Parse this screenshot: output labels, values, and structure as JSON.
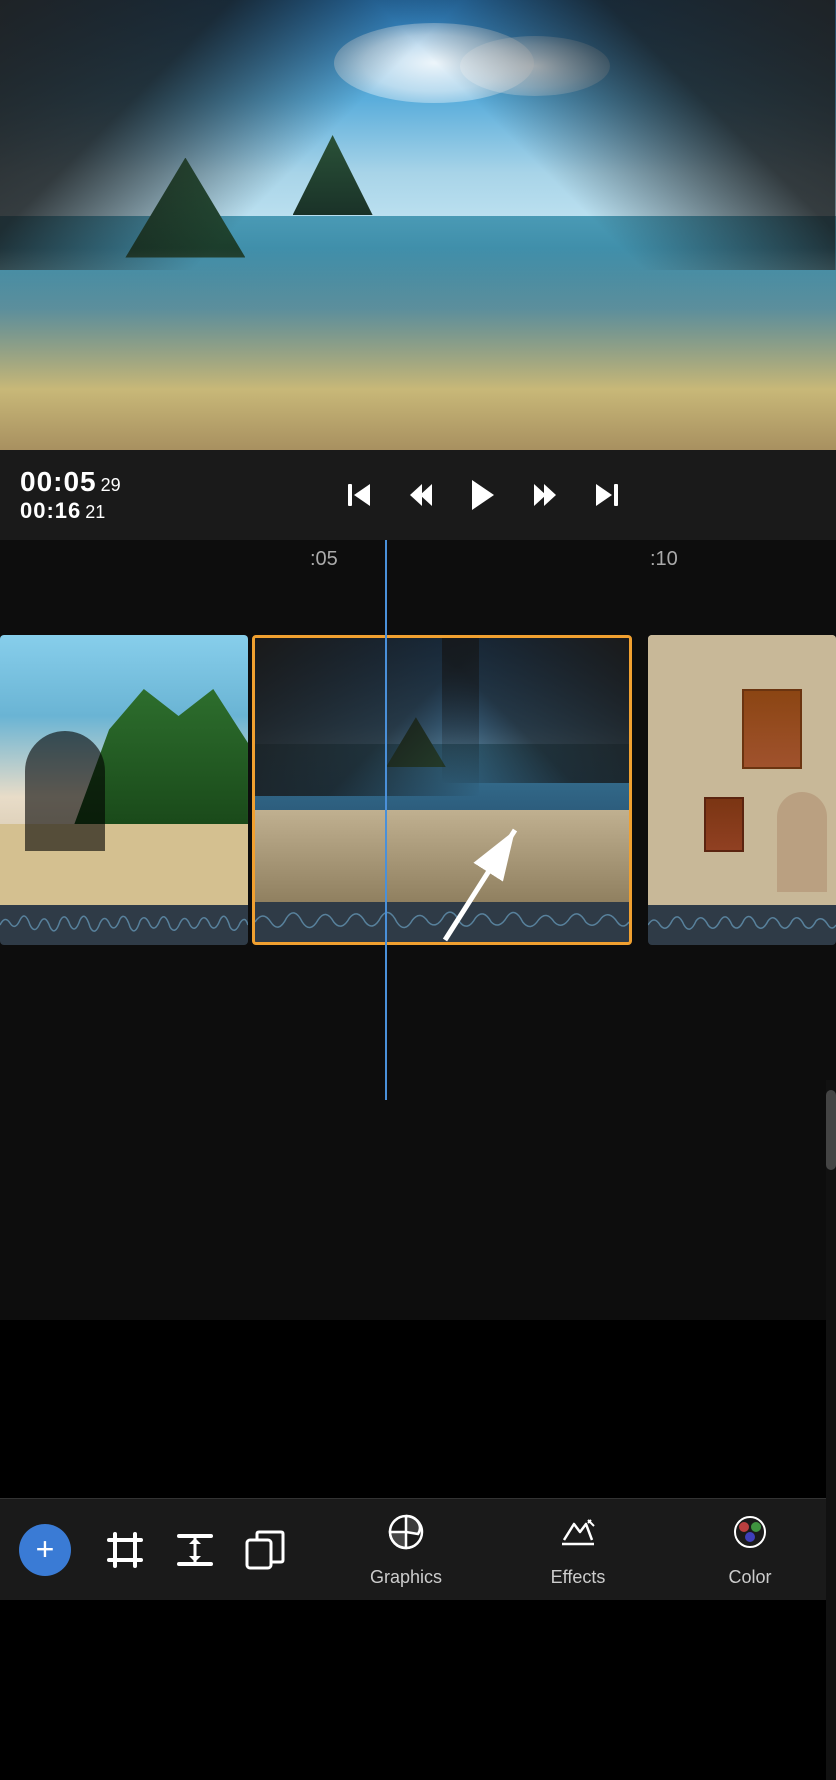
{
  "preview": {
    "alt": "Boat on ocean with islands in background"
  },
  "controls": {
    "timecode_current": "00:05",
    "timecode_current_frame": "29",
    "timecode_total": "00:16",
    "timecode_total_frame": "21"
  },
  "timeline": {
    "marker1": ":05",
    "marker2": ":10"
  },
  "clips": [
    {
      "id": "clip1",
      "label": "Beach girl clip",
      "selected": false
    },
    {
      "id": "clip2",
      "label": "Boat clip",
      "selected": true
    },
    {
      "id": "clip3",
      "label": "Building clip",
      "selected": false
    }
  ],
  "toolbar": {
    "add_label": "+",
    "tool1_label": "trim",
    "tool2_label": "split",
    "tool3_label": "duplicate",
    "nav_graphics": "Graphics",
    "nav_effects": "Effects",
    "nav_color": "Color"
  }
}
